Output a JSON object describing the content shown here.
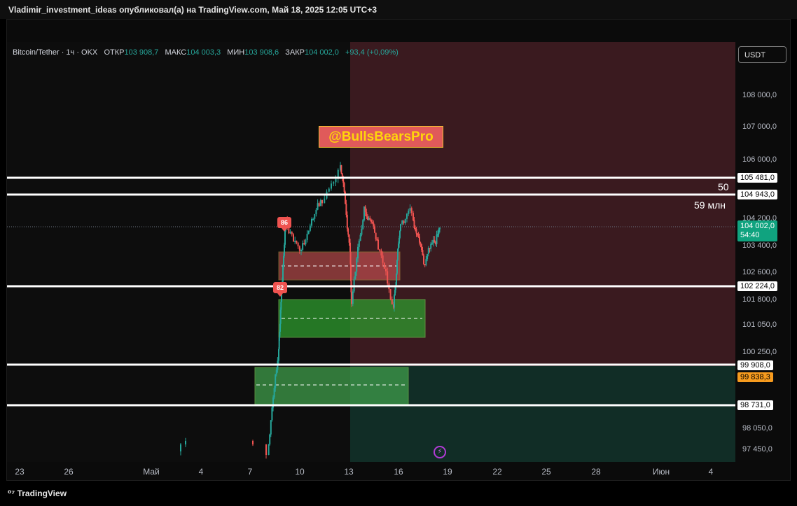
{
  "header": {
    "publisher_line": "Vladimir_investment_ideas опубликовал(а) на TradingView.com, Май 18, 2025 12:05 UTC+3"
  },
  "legend": {
    "symbol": "Bitcoin/Tether · 1ч · OKX",
    "open_label": "ОТКР",
    "open": "103 908,7",
    "high_label": "МАКС",
    "high": "104 003,3",
    "low_label": "МИН",
    "low": "103 908,6",
    "close_label": "ЗАКР",
    "close": "104 002,0",
    "change": "+93,4 (+0,09%)"
  },
  "currency_button": "USDT",
  "watermark": "@BullsBearsPro",
  "annotations": {
    "count": "50",
    "volume": "59 млн"
  },
  "markers": [
    {
      "label": "86"
    },
    {
      "label": "82"
    }
  ],
  "price_axis": {
    "ticks": [
      "108 000,0",
      "107 000,0",
      "106 000,0",
      "104 200,0",
      "103 400,0",
      "102 600,0",
      "101 800,0",
      "101 050,0",
      "100 250,0",
      "98 050,0",
      "97 450,0"
    ],
    "tags": [
      {
        "label": "105 481,0",
        "style": "white"
      },
      {
        "label": "104 943,0",
        "style": "white"
      },
      {
        "label": "102 224,0",
        "style": "white"
      },
      {
        "label": "99 908,0",
        "style": "white"
      },
      {
        "label": "99 838,3",
        "style": "orange"
      },
      {
        "label": "98 731,0",
        "style": "white"
      }
    ],
    "current_price": "104 002,0",
    "countdown": "54:40"
  },
  "time_axis": [
    "23",
    "26",
    "Май",
    "4",
    "7",
    "10",
    "13",
    "16",
    "19",
    "22",
    "25",
    "28",
    "Июн",
    "4"
  ],
  "footer": {
    "brand": "TradingView"
  },
  "colors": {
    "bull": "#26a69a",
    "bear": "#ef5350",
    "red_zone": "#3a1a1f",
    "green_zone": "#112d26",
    "orange_tag": "#f79b1e",
    "price_tag": "#10a37f"
  }
}
